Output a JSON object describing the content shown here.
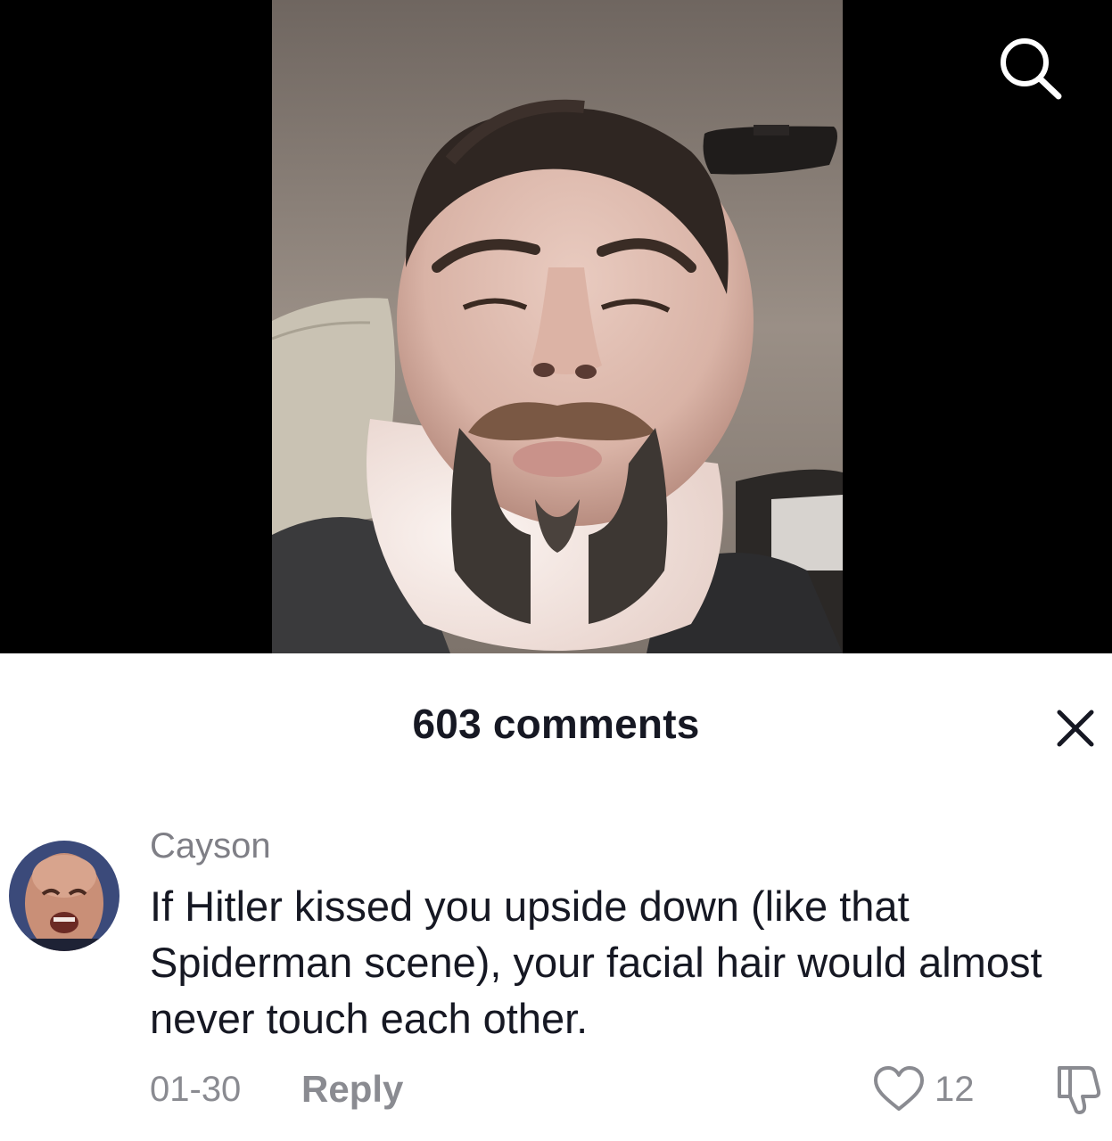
{
  "video": {
    "search_icon": "search-icon",
    "description_icon": "video-frame"
  },
  "comments_panel": {
    "title": "603 comments",
    "close_icon": "close-icon"
  },
  "comment": {
    "username": "Cayson",
    "text": "If Hitler kissed you upside down (like that Spiderman scene), your facial hair would almost never touch each other.",
    "date": "01-30",
    "reply_label": "Reply",
    "like_count": "12",
    "like_icon": "heart-icon",
    "dislike_icon": "thumbs-down-icon"
  },
  "colors": {
    "video_background": "#000000",
    "sheet_background": "#ffffff",
    "primary_text": "#161823",
    "secondary_text": "#8a8b91"
  }
}
